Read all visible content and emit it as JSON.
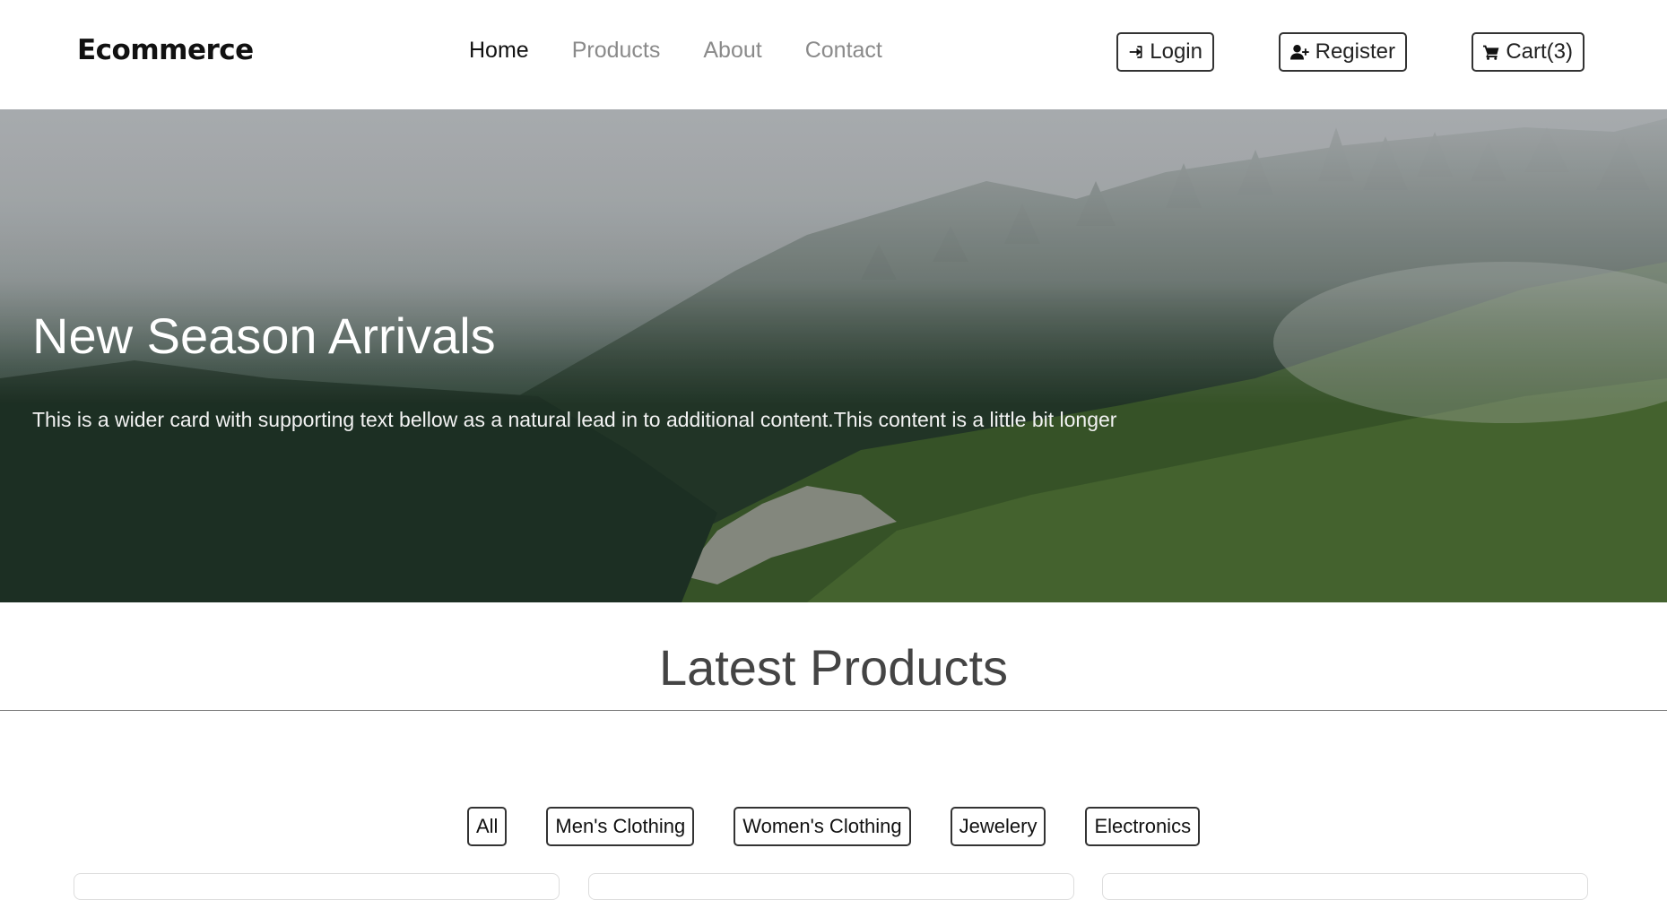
{
  "navbar": {
    "brand": "Ecommerce",
    "links": [
      {
        "label": "Home",
        "active": true
      },
      {
        "label": "Products",
        "active": false
      },
      {
        "label": "About",
        "active": false
      },
      {
        "label": "Contact",
        "active": false
      }
    ],
    "login_label": "Login",
    "register_label": "Register",
    "cart_label": "Cart(3)"
  },
  "hero": {
    "title": "New Season Arrivals",
    "text": "This is a wider card with supporting text bellow as a natural lead in to additional content.This content is a little bit longer"
  },
  "products": {
    "heading": "Latest Products",
    "filters": [
      "All",
      "Men's Clothing",
      "Women's Clothing",
      "Jewelery",
      "Electronics"
    ]
  },
  "icons": {
    "login": "sign-in-icon",
    "register": "user-plus-icon",
    "cart": "cart-icon"
  }
}
